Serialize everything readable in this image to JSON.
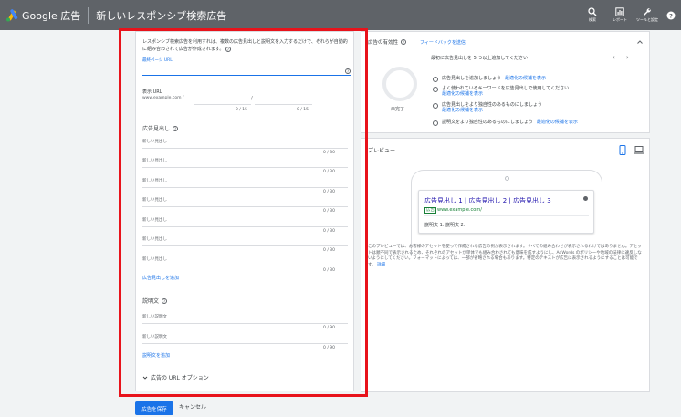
{
  "header": {
    "brand": "Google 広告",
    "page_title": "新しいレスポンシブ検索広告",
    "tools": [
      {
        "icon": "search-icon",
        "label": "検索"
      },
      {
        "icon": "reports-icon",
        "label": "レポート"
      },
      {
        "icon": "wrench-icon",
        "label": "ツールと設定"
      },
      {
        "icon": "help-icon",
        "label": ""
      }
    ]
  },
  "form": {
    "intro": "レスポンシブ検索広告を利用すれば、複数の広告見出しと説明文を入力するだけで、それらが自動的に組み合わされて広告が作成されます。",
    "final_url_label": "最終ページ URL",
    "display_url_label": "表示 URL",
    "display_url_domain": "www.example.com /",
    "path_separator": "/",
    "path1_count": "0 / 15",
    "path2_count": "0 / 15",
    "headlines_title": "広告見出し",
    "headlines": [
      {
        "placeholder": "新しい見出し",
        "count": "0 / 30"
      },
      {
        "placeholder": "新しい見出し",
        "count": "0 / 30"
      },
      {
        "placeholder": "新しい見出し",
        "count": "0 / 30"
      },
      {
        "placeholder": "新しい見出し",
        "count": "0 / 30"
      },
      {
        "placeholder": "新しい見出し",
        "count": "0 / 30"
      },
      {
        "placeholder": "新しい見出し",
        "count": "0 / 30"
      },
      {
        "placeholder": "新しい見出し",
        "count": "0 / 30"
      }
    ],
    "add_headline": "広告見出しを追加",
    "descriptions_title": "説明文",
    "descriptions": [
      {
        "placeholder": "新しい説明文",
        "count": "0 / 90"
      },
      {
        "placeholder": "新しい説明文",
        "count": "0 / 90"
      }
    ],
    "add_description": "説明文を追加",
    "url_options": "広告の URL オプション"
  },
  "strength": {
    "title": "広告の有効性",
    "feedback": "フィードバックを送信",
    "status": "未完了",
    "header": "最初に広告見出しを 5 つ以上追加してください",
    "suggestions": [
      {
        "text": "広告見出しを追加しましょう",
        "link": "最適化の候補を表示",
        "inline": true
      },
      {
        "text": "よく使われているキーワードを広告見出しで使用してください",
        "link": "最適化の候補を表示",
        "inline": false
      },
      {
        "text": "広告見出しをより独自性のあるものにしましょう",
        "link": "最適化の候補を表示",
        "inline": false
      },
      {
        "text": "説明文をより独自性のあるものにしましょう",
        "link": "最適化の候補を表示",
        "inline": true
      }
    ]
  },
  "preview": {
    "title": "プレビュー",
    "ad_headline": "広告見出し 1 | 広告見出し 2 | 広告見出し 3",
    "ad_badge": "広告",
    "ad_url": "www.example.com/",
    "ad_description": "説明文 1. 説明文 2.",
    "disclaimer": "このプレビューでは、お客様のアセットを使って作成される広告の例が表示されます。すべての組み合わせが表示されるわけではありません。アセットは順不同で表示されるため、それぞれのアセットが単体でも組み合わされても意味を成すようにし、AdWords のポリシーや地域の法律に違反しないようにしてください。フォーマットによっては、一部が省略される場合もあります。特定のテキストが広告に表示されるようにすることは可能です。",
    "disclaimer_link": "詳細"
  },
  "actions": {
    "save": "広告を保存",
    "cancel": "キャンセル"
  }
}
